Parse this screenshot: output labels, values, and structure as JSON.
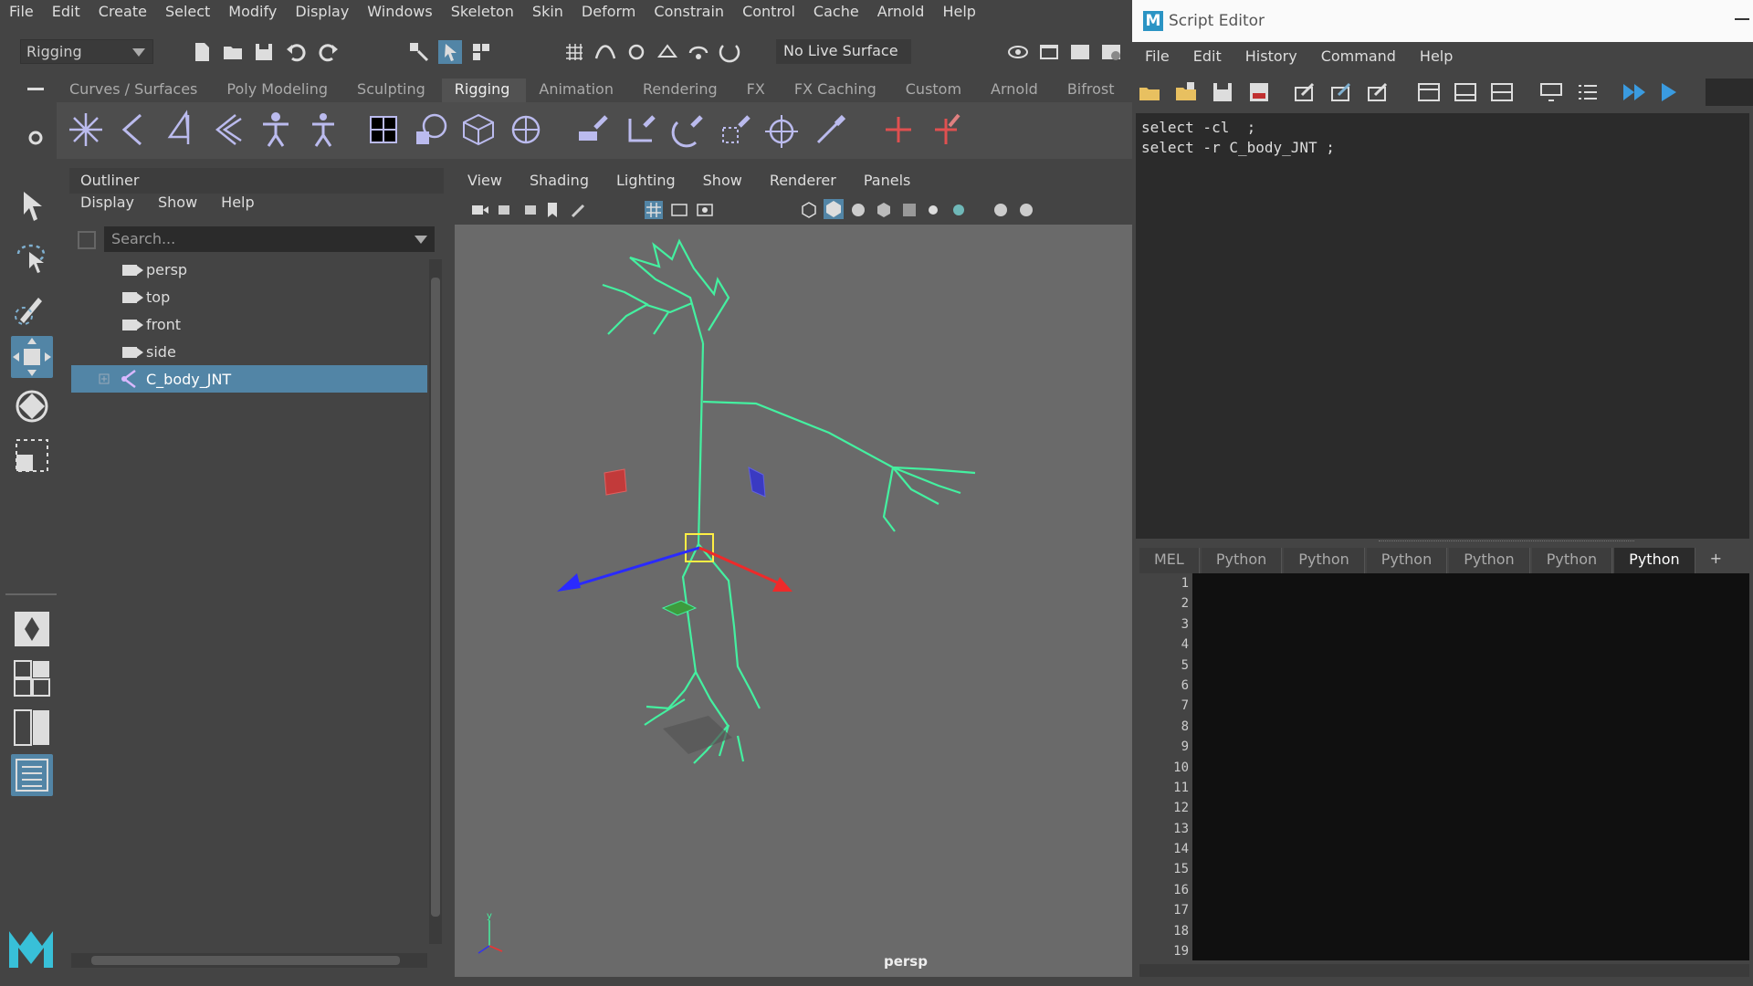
{
  "menubar": {
    "items": [
      "File",
      "Edit",
      "Create",
      "Select",
      "Modify",
      "Display",
      "Windows",
      "Skeleton",
      "Skin",
      "Deform",
      "Constrain",
      "Control",
      "Cache",
      "Arnold",
      "Help"
    ]
  },
  "statusline": {
    "mode": "Rigging",
    "live_surface": "No Live Surface"
  },
  "shelf": {
    "tabs": [
      "Curves / Surfaces",
      "Poly Modeling",
      "Sculpting",
      "Rigging",
      "Animation",
      "Rendering",
      "FX",
      "FX Caching",
      "Custom",
      "Arnold",
      "Bifrost"
    ],
    "active_tab": "Rigging"
  },
  "outliner": {
    "title": "Outliner",
    "menu": [
      "Display",
      "Show",
      "Help"
    ],
    "search_placeholder": "Search...",
    "items": [
      {
        "label": "persp",
        "icon": "camera-icon"
      },
      {
        "label": "top",
        "icon": "camera-icon"
      },
      {
        "label": "front",
        "icon": "camera-icon"
      },
      {
        "label": "side",
        "icon": "camera-icon"
      },
      {
        "label": "C_body_JNT",
        "icon": "joint-icon",
        "selected": true
      }
    ]
  },
  "viewport": {
    "menu": [
      "View",
      "Shading",
      "Lighting",
      "Show",
      "Renderer",
      "Panels"
    ],
    "camera_label": "persp"
  },
  "script_editor": {
    "title": "Script Editor",
    "menu": [
      "File",
      "Edit",
      "History",
      "Command",
      "Help"
    ],
    "history": [
      "select -cl  ;",
      "select -r C_body_JNT ;"
    ],
    "tabs": [
      "MEL",
      "Python",
      "Python",
      "Python",
      "Python",
      "Python",
      "Python"
    ],
    "active_tab_index": 6,
    "add_tab": "+",
    "line_numbers": [
      "1",
      "2",
      "3",
      "4",
      "5",
      "6",
      "7",
      "8",
      "9",
      "10",
      "11",
      "12",
      "13",
      "14",
      "15",
      "16",
      "17",
      "18",
      "19"
    ]
  },
  "colors": {
    "selection": "#5285a6",
    "joint": "#44f0a0",
    "viewport_bg": "#6a6a6a"
  }
}
